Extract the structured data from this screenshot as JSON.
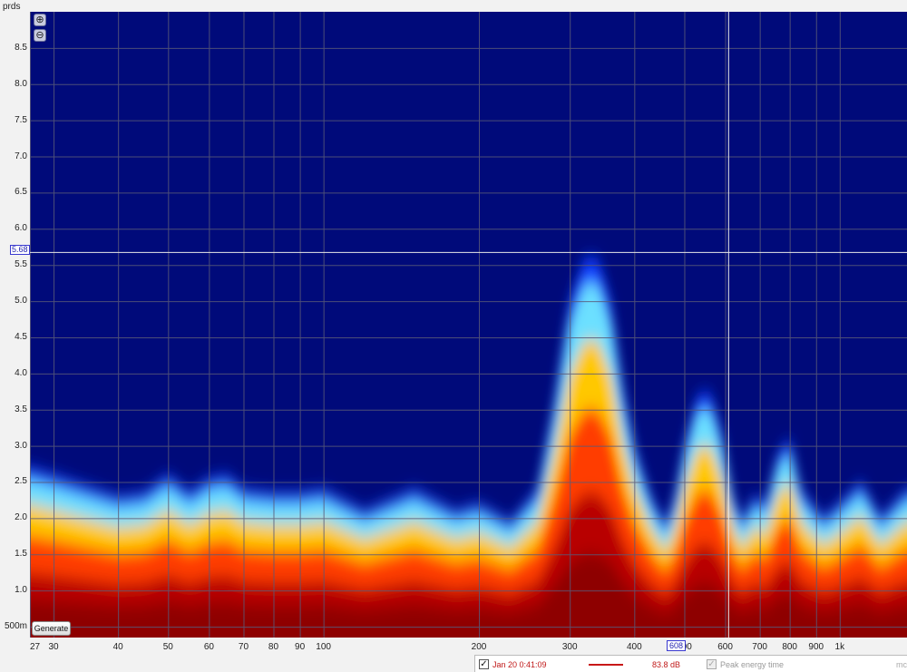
{
  "axes": {
    "y_title": "prds",
    "y_ticks": [
      "8.5",
      "8.0",
      "7.5",
      "7.0",
      "6.5",
      "6.0",
      "5.5",
      "5.0",
      "4.5",
      "4.0",
      "3.5",
      "3.0",
      "2.5",
      "2.0",
      "1.5",
      "1.0",
      "500m"
    ],
    "x_ticks": [
      "27",
      "30",
      "40",
      "50",
      "60",
      "70",
      "80",
      "90",
      "100",
      "200",
      "300",
      "400",
      "500",
      "600",
      "700",
      "800",
      "900",
      "1k"
    ]
  },
  "cursor": {
    "y_readout": "5.68",
    "x_readout": "608"
  },
  "controls": {
    "zoom_in": "⊕",
    "zoom_out": "⊖",
    "generate_label": "Generate"
  },
  "legend": {
    "checkbox_mark": "✓",
    "title": "Jan 20 0:41:09",
    "line_color": "#c81818",
    "level": "83.8 dB",
    "peak_energy_label": "Peak energy time",
    "units_label": "mc"
  },
  "chart_data": {
    "type": "heatmap",
    "xlabel": "",
    "ylabel": "prds",
    "x_scale": "log",
    "xlim": [
      27,
      1350
    ],
    "ylim": [
      0.35,
      9.0
    ],
    "colormap": [
      "#8e0000",
      "#ff3c00",
      "#ffc800",
      "#6ce0ff",
      "#0a3cff",
      "#000a7a"
    ],
    "cursor": {
      "x": 608,
      "y": 5.68
    },
    "decay_envelope": {
      "x": [
        27,
        30,
        33,
        40,
        45,
        50,
        55,
        60,
        65,
        70,
        80,
        90,
        100,
        120,
        150,
        180,
        200,
        230,
        260,
        280,
        300,
        320,
        340,
        360,
        380,
        400,
        430,
        460,
        480,
        500,
        530,
        560,
        590,
        620,
        650,
        680,
        720,
        760,
        800,
        840,
        880,
        930,
        1000,
        1100,
        1200,
        1350
      ],
      "y": [
        2.7,
        2.6,
        2.5,
        2.3,
        2.35,
        2.6,
        2.35,
        2.55,
        2.6,
        2.4,
        2.35,
        2.35,
        2.4,
        2.1,
        2.4,
        2.1,
        2.2,
        1.95,
        2.4,
        3.6,
        5.0,
        5.6,
        5.6,
        5.0,
        3.8,
        3.0,
        2.3,
        1.9,
        2.3,
        3.0,
        3.7,
        3.75,
        3.2,
        2.3,
        1.95,
        2.3,
        2.2,
        2.9,
        3.1,
        2.4,
        2.2,
        2.0,
        2.2,
        2.5,
        2.0,
        2.4
      ]
    }
  }
}
